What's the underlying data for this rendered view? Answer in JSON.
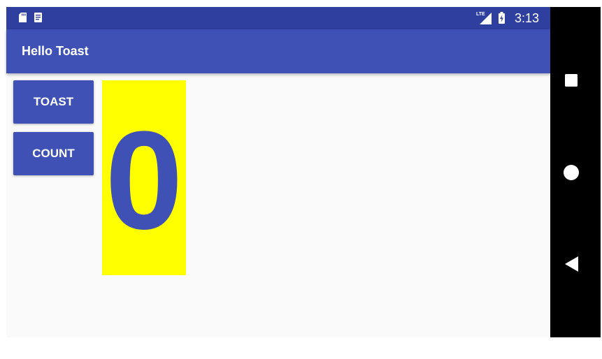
{
  "status_bar": {
    "network": "LTE",
    "time": "3:13",
    "left_icons": [
      "sd-card-icon",
      "notes-icon"
    ],
    "right_icons": [
      "lte-signal-icon",
      "battery-charging-icon"
    ]
  },
  "app_bar": {
    "title": "Hello Toast"
  },
  "buttons": {
    "toast_label": "TOAST",
    "count_label": "COUNT"
  },
  "counter": {
    "value": "0"
  },
  "navigation": {
    "icons": [
      "recent-apps-icon",
      "home-icon",
      "back-icon"
    ]
  },
  "colors": {
    "status_bar": "#2f3f9f",
    "primary": "#3f51b5",
    "count_background": "#ffff00",
    "count_text": "#3f51b5",
    "background": "#fafafa",
    "nav_bar": "#000000"
  }
}
